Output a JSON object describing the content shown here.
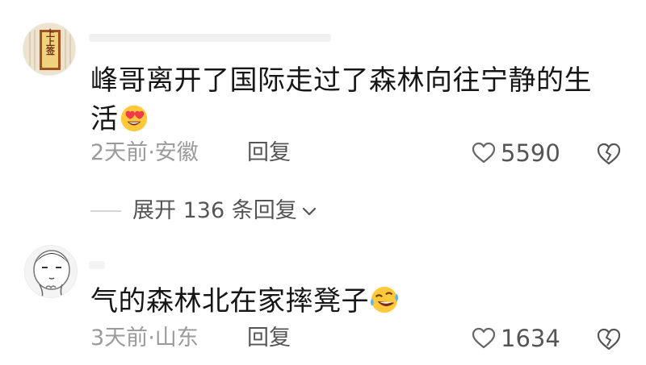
{
  "comments": [
    {
      "text": "峰哥离开了国际走过了森林向往宁静的生活",
      "emoji": "heart-eyes-emoji",
      "time": "2天前",
      "location": "安徽",
      "reply_label": "回复",
      "likes": "5590",
      "avatar_text": "上上签"
    },
    {
      "text": "气的森林北在家摔凳子",
      "emoji": "laughing-crying-emoji",
      "time": "3天前",
      "location": "山东",
      "reply_label": "回复",
      "likes": "1634"
    }
  ],
  "expand_replies": "展开 136 条回复",
  "meta_separator": "·",
  "colors": {
    "text": "#161616",
    "meta": "#9a9a9a",
    "action": "#555555"
  }
}
